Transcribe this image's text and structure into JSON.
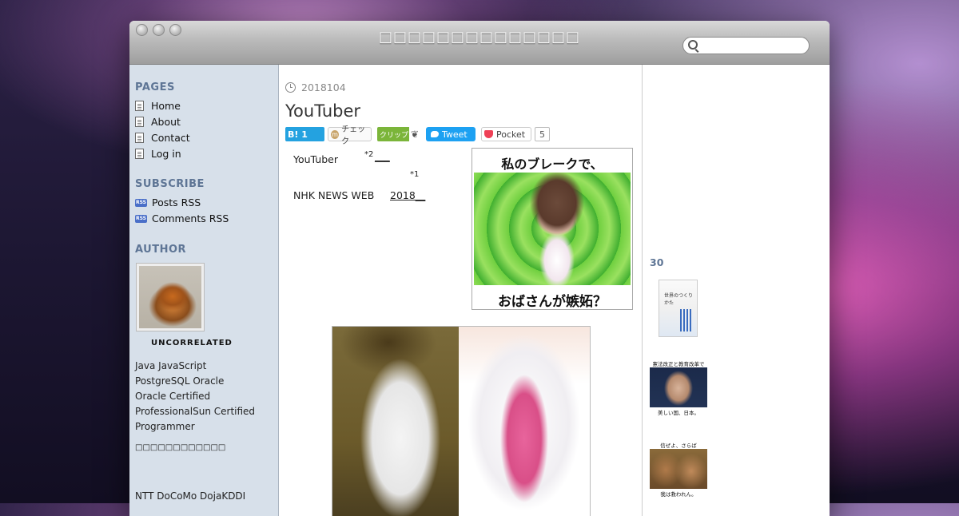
{
  "window": {
    "title": "□□□□□□□□□□□□□□"
  },
  "search": {
    "placeholder": ""
  },
  "sidebar": {
    "pages_heading": "PAGES",
    "pages": [
      {
        "label": "Home"
      },
      {
        "label": "About"
      },
      {
        "label": "Contact"
      },
      {
        "label": "Log in"
      }
    ],
    "subscribe_heading": "SUBSCRIBE",
    "subscribe": [
      {
        "label": "Posts RSS"
      },
      {
        "label": "Comments RSS"
      }
    ],
    "rss_badge": "RSS",
    "author_heading": "AUTHOR",
    "author_name": "UNCORRELATED",
    "bio": [
      "Java JavaScript",
      "PostgreSQL Oracle",
      "Oracle Certified",
      "ProfessionalSun Certified",
      "Programmer"
    ],
    "bio_note": "□□□□□□□□□□□□",
    "bio_more": "NTT DoCoMo DojaKDDI"
  },
  "post": {
    "date": "2018104",
    "title": "YouTuber",
    "share": {
      "hatena": "B! 1",
      "check_icon": "m",
      "check": "チェック",
      "clip": "クリップ",
      "tweet": "Tweet",
      "pocket": "Pocket",
      "pocket_count": "5"
    },
    "text": {
      "line1": "YouTuber",
      "fn2": "*2",
      "fn2_link": "___",
      "fn1": "*1",
      "line2": "NHK NEWS WEB",
      "line2_link": "2018__"
    },
    "image1": {
      "top_caption": "私のブレークで、",
      "bottom_caption": "おばさんが嫉妬？"
    }
  },
  "right": {
    "heading": "30",
    "book1_title": "世界のつくりかた",
    "book2_top": "憲法改正と教育改革で",
    "book2_bottom": "美しい国、日本。",
    "book3_top": "信ぜよ、さらば",
    "book3_bottom": "我は救われん。"
  },
  "colors": {
    "accent_heading": "#5e7595",
    "sidebar_bg": "#d7e0ea",
    "hatena": "#24a2e0",
    "tweet": "#1da1f2",
    "pocket": "#ef4056",
    "clip": "#7bb53a"
  }
}
